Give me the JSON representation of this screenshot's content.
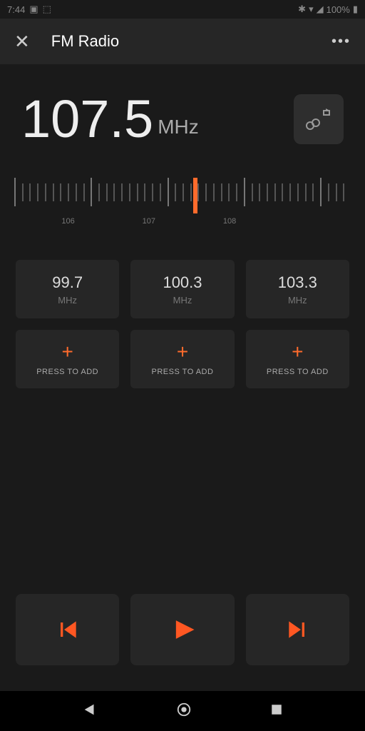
{
  "status": {
    "time": "7:44",
    "battery": "100%"
  },
  "header": {
    "title": "FM Radio"
  },
  "frequency": {
    "value": "107.5",
    "unit": "MHz"
  },
  "dial": {
    "labels": [
      "106",
      "107",
      "108"
    ]
  },
  "presets": [
    {
      "type": "station",
      "freq": "99.7",
      "unit": "MHz"
    },
    {
      "type": "station",
      "freq": "100.3",
      "unit": "MHz"
    },
    {
      "type": "station",
      "freq": "103.3",
      "unit": "MHz"
    },
    {
      "type": "add",
      "label": "PRESS TO ADD"
    },
    {
      "type": "add",
      "label": "PRESS TO ADD"
    },
    {
      "type": "add",
      "label": "PRESS TO ADD"
    }
  ]
}
